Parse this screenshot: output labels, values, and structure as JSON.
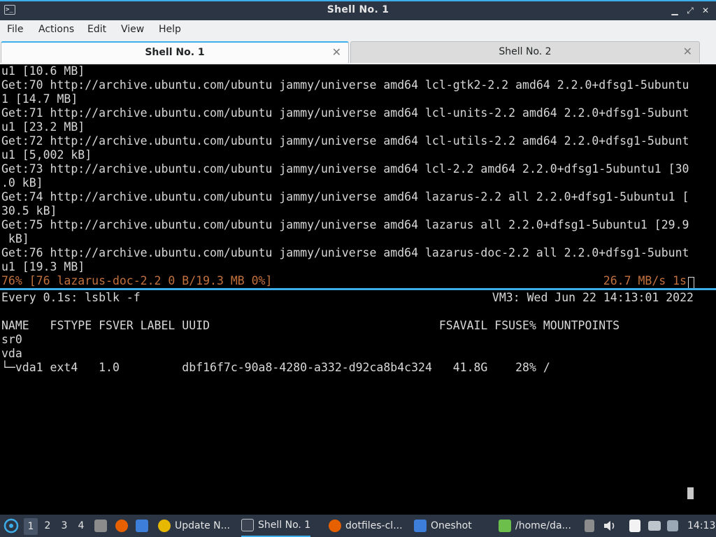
{
  "window": {
    "title": "Shell No. 1",
    "app_icon_glyph": ">_",
    "buttons": {
      "minimize": "▁",
      "maximize": "⤢",
      "close": "✕"
    }
  },
  "menu": [
    "File",
    "Actions",
    "Edit",
    "View",
    "Help"
  ],
  "tabs": [
    {
      "label": "Shell No. 1",
      "close": "✕",
      "active": true
    },
    {
      "label": "Shell No. 2",
      "close": "✕",
      "active": false
    }
  ],
  "terminal_top": {
    "lines": [
      "u1 [10.6 MB]",
      "Get:70 http://archive.ubuntu.com/ubuntu jammy/universe amd64 lcl-gtk2-2.2 amd64 2.2.0+dfsg1-5ubuntu",
      "1 [14.7 MB]",
      "Get:71 http://archive.ubuntu.com/ubuntu jammy/universe amd64 lcl-units-2.2 amd64 2.2.0+dfsg1-5ubunt",
      "u1 [23.2 MB]",
      "Get:72 http://archive.ubuntu.com/ubuntu jammy/universe amd64 lcl-utils-2.2 amd64 2.2.0+dfsg1-5ubunt",
      "u1 [5,002 kB]",
      "Get:73 http://archive.ubuntu.com/ubuntu jammy/universe amd64 lcl-2.2 amd64 2.2.0+dfsg1-5ubuntu1 [30",
      ".0 kB]",
      "Get:74 http://archive.ubuntu.com/ubuntu jammy/universe amd64 lazarus-2.2 all 2.2.0+dfsg1-5ubuntu1 [",
      "30.5 kB]",
      "Get:75 http://archive.ubuntu.com/ubuntu jammy/universe amd64 lazarus all 2.2.0+dfsg1-5ubuntu1 [29.9",
      " kB]",
      "Get:76 http://archive.ubuntu.com/ubuntu jammy/universe amd64 lazarus-doc-2.2 all 2.2.0+dfsg1-5ubunt",
      "u1 [19.3 MB]"
    ],
    "progress_left": "76% [76 lazarus-doc-2.2 0 B/19.3 MB 0%]",
    "progress_right": "26.7 MB/s 1s"
  },
  "terminal_bottom": {
    "header_left": "Every 0.1s: lsblk -f",
    "header_right": "VM3: Wed Jun 22 14:13:01 2022",
    "table_header": "NAME   FSTYPE FSVER LABEL UUID                                 FSAVAIL FSUSE% MOUNTPOINTS",
    "rows": [
      "sr0",
      "vda",
      "└─vda1 ext4   1.0         dbf16f7c-90a8-4280-a332-d92ca8b4c324   41.8G    28% /"
    ]
  },
  "taskbar": {
    "desktops": [
      "1",
      "2",
      "3",
      "4"
    ],
    "tasks": [
      {
        "label": "Update N...",
        "icon": "update-icon",
        "color": "#e6b800"
      },
      {
        "label": "Shell No. 1",
        "icon": "terminal-icon",
        "color": "#3b4252"
      },
      {
        "label": "dotfiles-cl...",
        "icon": "firefox-icon",
        "color": "#e66000"
      },
      {
        "label": "Oneshot",
        "icon": "folder-icon",
        "color": "#3d7edb"
      },
      {
        "label": "/home/da...",
        "icon": "editor-icon",
        "color": "#6cbf4a"
      }
    ],
    "clock": "14:13"
  }
}
